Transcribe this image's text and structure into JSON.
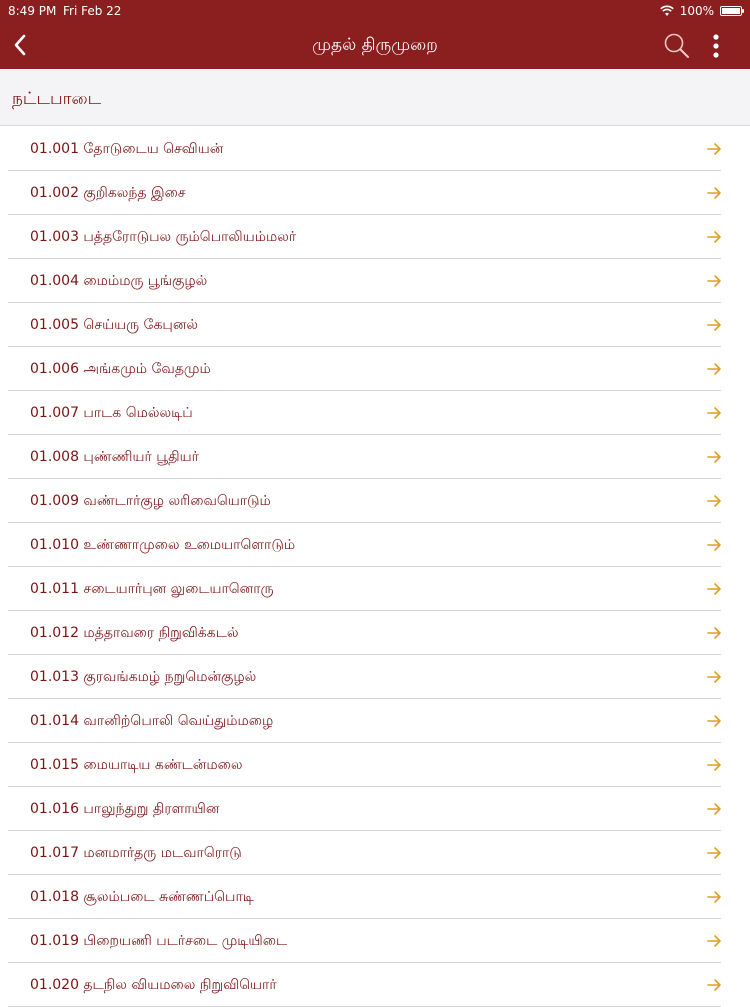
{
  "status_bar": {
    "time": "8:49 PM",
    "date": "Fri Feb 22",
    "battery": "100%",
    "battery_level": 1.0
  },
  "nav": {
    "title": "முதல் திருமுறை",
    "back_icon": "chevron-left-icon",
    "search_icon": "search-icon",
    "more_icon": "more-vertical-icon"
  },
  "section": {
    "title": "நட்டபாடை"
  },
  "colors": {
    "brand": "#8b1f1f",
    "text": "#7a1515",
    "arrow": "#e0a020",
    "header_bg": "#f4f4f6"
  },
  "items": [
    {
      "label": "01.001 தோடுடைய செவியன்"
    },
    {
      "label": "01.002 குறிகலந்த இசை"
    },
    {
      "label": "01.003 பத்தரோடுபல ரும்பொலியம்மலர்"
    },
    {
      "label": "01.004 மைம்மரு பூங்குழல்"
    },
    {
      "label": "01.005 செய்யரு கேபுனல்"
    },
    {
      "label": "01.006 அங்கமும் வேதமும்"
    },
    {
      "label": "01.007 பாடக மெல்லடிப்"
    },
    {
      "label": "01.008 புண்ணியர் பூதியர்"
    },
    {
      "label": "01.009 வண்டார்குழ லரிவையொடும்"
    },
    {
      "label": "01.010 உண்ணாமுலை உமையாளொடும்"
    },
    {
      "label": "01.011 சடையார்புன லுடையானொரு"
    },
    {
      "label": "01.012 மத்தாவரை நிறுவிக்கடல்"
    },
    {
      "label": "01.013 குரவங்கமழ் நறுமென்குழல்"
    },
    {
      "label": "01.014 வானிற்பொலி வெய்தும்மழை"
    },
    {
      "label": "01.015 மையாடிய கண்டன்மலை"
    },
    {
      "label": "01.016 பாலுந்துறு திரளாயின"
    },
    {
      "label": "01.017 மனமார்தரு மடவாரொடு"
    },
    {
      "label": "01.018 சூலம்படை சுண்ணப்பொடி"
    },
    {
      "label": "01.019 பிறையணி படர்சடை முடியிடை"
    },
    {
      "label": "01.020 தடநில வியமலை நிறுவியொர்"
    }
  ]
}
